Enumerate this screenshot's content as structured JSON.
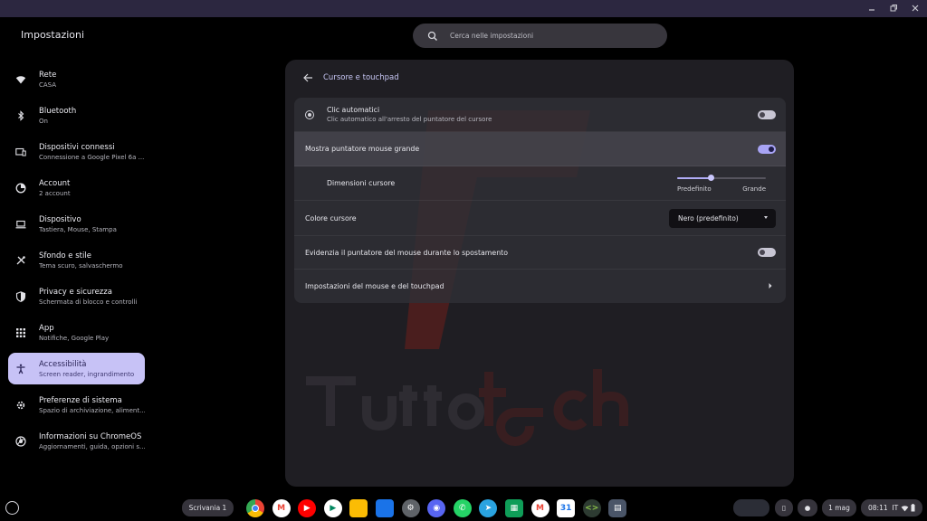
{
  "app": {
    "title": "Impostazioni"
  },
  "search": {
    "placeholder": "Cerca nelle impostazioni"
  },
  "sidebar": {
    "items": [
      {
        "label": "Rete",
        "sub": "CASA",
        "icon": "wifi-icon"
      },
      {
        "label": "Bluetooth",
        "sub": "On",
        "icon": "bluetooth-icon"
      },
      {
        "label": "Dispositivi connessi",
        "sub": "Connessione a Google Pixel 6a ...",
        "icon": "devices-icon"
      },
      {
        "label": "Account",
        "sub": "2 account",
        "icon": "account-icon"
      },
      {
        "label": "Dispositivo",
        "sub": "Tastiera, Mouse, Stampa",
        "icon": "laptop-icon"
      },
      {
        "label": "Sfondo e stile",
        "sub": "Tema scuro, salvaschermo",
        "icon": "palette-icon"
      },
      {
        "label": "Privacy e sicurezza",
        "sub": "Schermata di blocco e controlli",
        "icon": "shield-icon"
      },
      {
        "label": "App",
        "sub": "Notifiche, Google Play",
        "icon": "apps-grid-icon"
      },
      {
        "label": "Accessibilità",
        "sub": "Screen reader, ingrandimento",
        "icon": "accessibility-icon",
        "active": true
      },
      {
        "label": "Preferenze di sistema",
        "sub": "Spazio di archiviazione, aliment...",
        "icon": "gear-icon"
      },
      {
        "label": "Informazioni su ChromeOS",
        "sub": "Aggiornamenti, guida, opzioni s...",
        "icon": "chromeos-icon"
      }
    ]
  },
  "page": {
    "title": "Cursore e touchpad",
    "rows": {
      "auto_click": {
        "label": "Clic automatici",
        "sub": "Clic automatico all'arresto del puntatore del cursore",
        "enabled": false
      },
      "large_cursor": {
        "label": "Mostra puntatore mouse grande",
        "enabled": true
      },
      "cursor_size": {
        "label": "Dimensioni cursore",
        "min_label": "Predefinito",
        "max_label": "Grande",
        "value": 0.38
      },
      "cursor_color": {
        "label": "Colore cursore",
        "value": "Nero (predefinito)"
      },
      "highlight_cursor": {
        "label": "Evidenzia il puntatore del mouse durante lo spostamento",
        "enabled": false
      },
      "mouse_settings": {
        "label": "Impostazioni del mouse e del touchpad"
      }
    }
  },
  "shelf": {
    "desk_label": "Scrivania 1",
    "apps": [
      "Chrome",
      "Gmail",
      "YouTube",
      "Play Store",
      "Keep",
      "Files",
      "Settings",
      "Discord",
      "WhatsApp",
      "Telegram",
      "Sheets",
      "Gmail",
      "Calendar",
      "Terminal",
      "Text"
    ],
    "date": "1 mag",
    "time": "08:11",
    "ime": "IT"
  },
  "colors": {
    "accent": "#c7c2f6",
    "toggle_on": "#a8a4f5",
    "card_bg": "#1f1e23",
    "watermark": "#7a1f1a"
  }
}
